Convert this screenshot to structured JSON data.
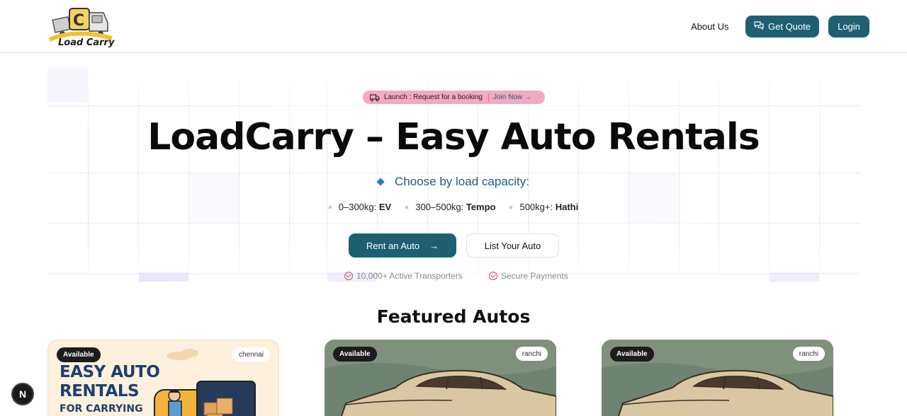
{
  "header": {
    "logo_text": "Load Carry",
    "nav_about": "About Us",
    "quote_label": "Get Quote",
    "login_label": "Login"
  },
  "announcement": {
    "text": "Launch :  Request for a booking",
    "link": "Join Now"
  },
  "hero": {
    "title": "LoadCarry – Easy Auto Rentals",
    "subtitle": "Choose by load capacity:",
    "capacities": [
      {
        "range": "0–300kg:",
        "type": "EV"
      },
      {
        "range": "300–500kg:",
        "type": "Tempo"
      },
      {
        "range": "500kg+:",
        "type": "Hathi"
      }
    ],
    "rent_label": "Rent an Auto",
    "list_label": "List Your Auto",
    "trust": [
      "10,000+ Active Transporters",
      "Secure Payments"
    ]
  },
  "featured": {
    "title": "Featured Autos",
    "cards": [
      {
        "status": "Available",
        "city": "chennai",
        "promo": [
          "EASY AUTO",
          "RENTALS",
          "FOR CARRYING"
        ]
      },
      {
        "status": "Available",
        "city": "ranchi"
      },
      {
        "status": "Available",
        "city": "ranchi"
      }
    ]
  },
  "floating": {
    "label": "N"
  },
  "colors": {
    "brand": "#1e5f74",
    "pill": "#f3a9c1",
    "accent_check": "#d8445f"
  }
}
